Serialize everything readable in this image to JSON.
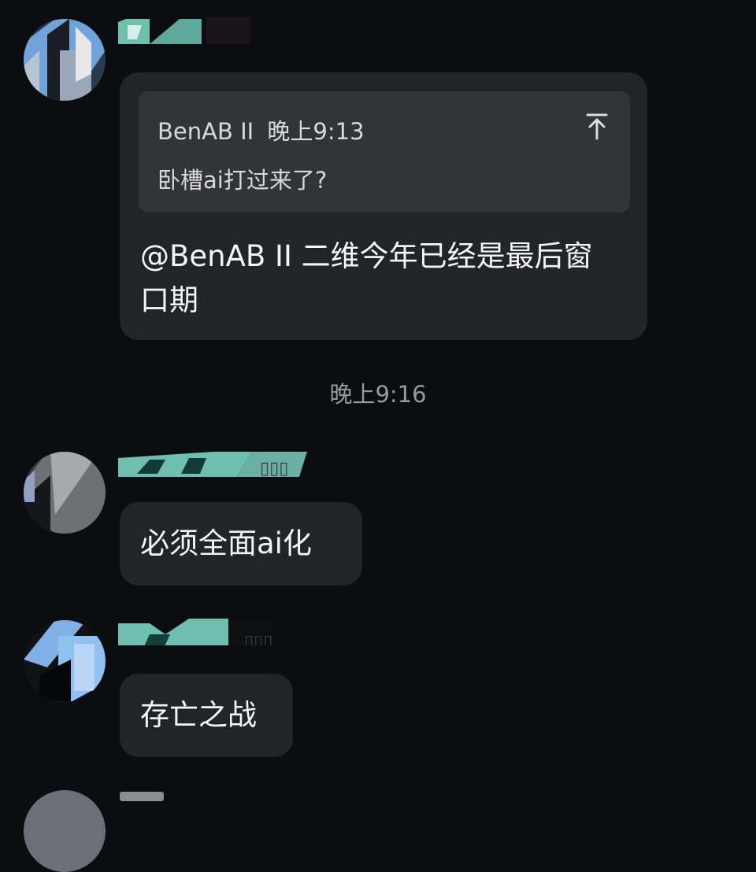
{
  "messages": [
    {
      "quote": {
        "author": "BenAB II",
        "time": "晚上9:13",
        "text": "卧槽ai打过来了?"
      },
      "text": "@BenAB II 二维今年已经是最后窗口期"
    },
    {
      "text": "必须全面ai化"
    },
    {
      "text": "存亡之战"
    }
  ],
  "time_divider": "晚上9:16",
  "icons": {
    "quote_jump": "arrow-up-to-top-icon"
  },
  "colors": {
    "background": "#0c0d10",
    "bubble": "#232428",
    "quote_block": "#333438",
    "name_tint": "#6fbfb0"
  }
}
